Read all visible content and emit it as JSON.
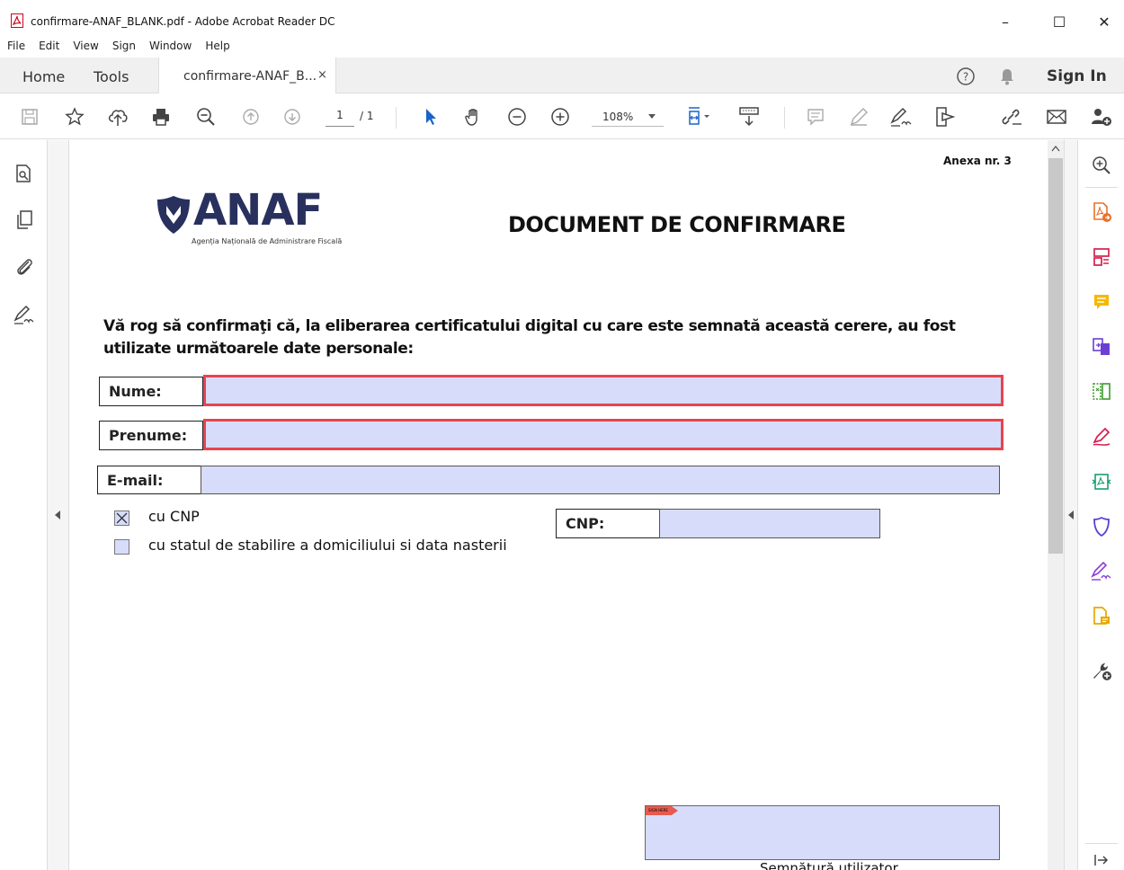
{
  "window": {
    "title": "confirmare-ANAF_BLANK.pdf - Adobe Acrobat Reader DC",
    "minimize": "–",
    "maximize": "☐",
    "close": "✕"
  },
  "menu": [
    "File",
    "Edit",
    "View",
    "Sign",
    "Window",
    "Help"
  ],
  "tabs": {
    "home": "Home",
    "tools": "Tools",
    "document": "confirmare-ANAF_B...",
    "close": "×",
    "sign_in": "Sign In"
  },
  "toolbar": {
    "page_current": "1",
    "page_total": "/ 1",
    "zoom": "108%"
  },
  "document": {
    "annex": "Anexa nr. 3",
    "logo_text": "ANAF",
    "logo_subtitle": "Agenția Națională de Administrare Fiscală",
    "title": "DOCUMENT DE CONFIRMARE",
    "intro_line1": "Vă rog să confirmaţi că, la eliberarea certificatului digital cu care este semnată această cerere, au fost",
    "intro_line2": "utilizate următoarele date personale:",
    "label_nume": "Nume:",
    "label_prenume": "Prenume:",
    "label_email": "E-mail:",
    "option_cnp": "cu CNP",
    "option_domiciliu": "cu statul de stabilire a domiciliului si data nasterii",
    "label_cnp": "CNP:",
    "signature_caption": "Semnătură utilizator",
    "signature_flag": "SIGN HERE"
  },
  "colors": {
    "field_fill": "#d6dcfa",
    "required_border": "#e8434f",
    "anaf_navy": "#28305e"
  }
}
